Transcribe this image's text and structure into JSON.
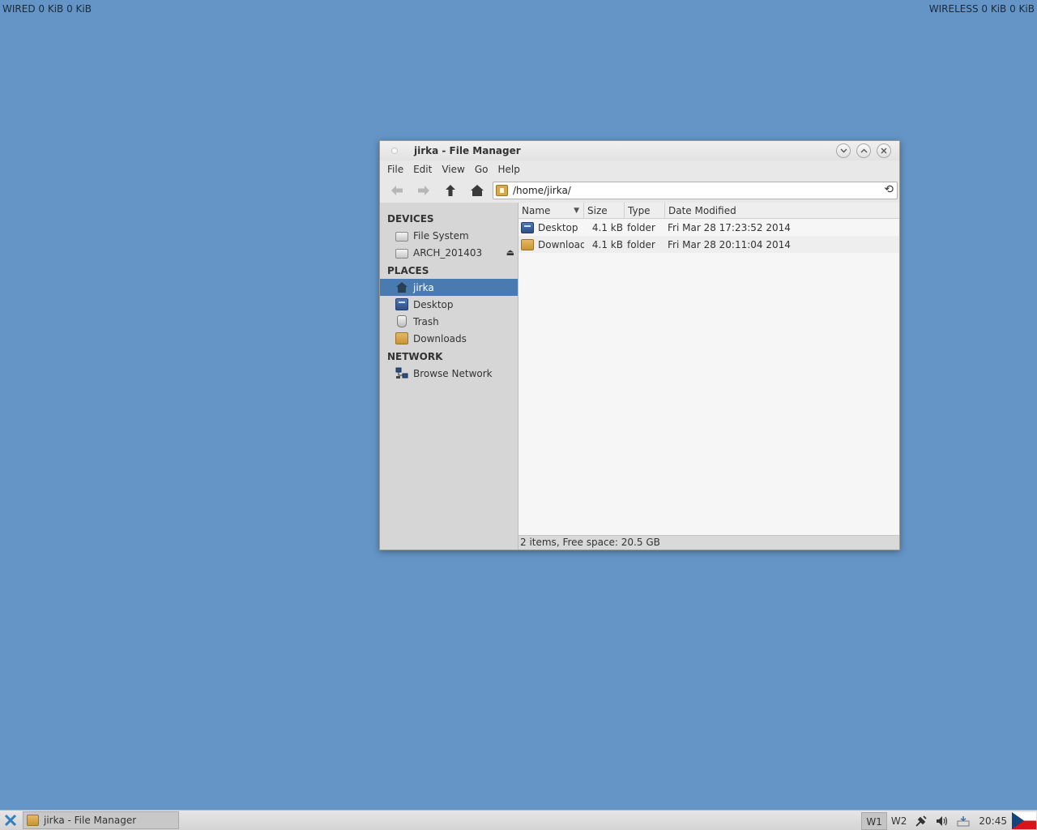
{
  "desktop": {
    "wired_status": "WIRED 0 KiB 0 KiB",
    "wireless_status": "WIRELESS 0 KiB 0 KiB"
  },
  "window": {
    "title": "jirka - File Manager",
    "menu": [
      "File",
      "Edit",
      "View",
      "Go",
      "Help"
    ],
    "address": "/home/jirka/"
  },
  "sidebar": {
    "devices_header": "DEVICES",
    "devices": [
      {
        "label": "File System",
        "icon": "drive-icon"
      },
      {
        "label": "ARCH_201403",
        "icon": "drive-icon"
      }
    ],
    "places_header": "PLACES",
    "places": [
      {
        "label": "jirka",
        "icon": "home-icon",
        "selected": true
      },
      {
        "label": "Desktop",
        "icon": "desktop-folder-icon"
      },
      {
        "label": "Trash",
        "icon": "trash-icon"
      },
      {
        "label": "Downloads",
        "icon": "folder-icon"
      }
    ],
    "network_header": "NETWORK",
    "network": [
      {
        "label": "Browse Network",
        "icon": "network-icon"
      }
    ]
  },
  "file_list": {
    "columns": [
      "Name",
      "Size",
      "Type",
      "Date Modified"
    ],
    "rows": [
      {
        "name": "Desktop",
        "size": "4.1 kB",
        "type": "folder",
        "modified": "Fri Mar 28 17:23:52 2014",
        "icon": "desktop-folder-icon"
      },
      {
        "name": "Downloads",
        "size": "4.1 kB",
        "type": "folder",
        "modified": "Fri Mar 28 20:11:04 2014",
        "icon": "folder-icon"
      }
    ]
  },
  "status_bar": "2 items, Free space: 20.5 GB",
  "taskbar": {
    "task_label": "jirka - File Manager",
    "workspaces": [
      "W1",
      "W2"
    ],
    "active_workspace": "W1",
    "clock": "20:45",
    "colors": {
      "selection": "#4a7bb0",
      "desktop": "#6495c6"
    }
  }
}
